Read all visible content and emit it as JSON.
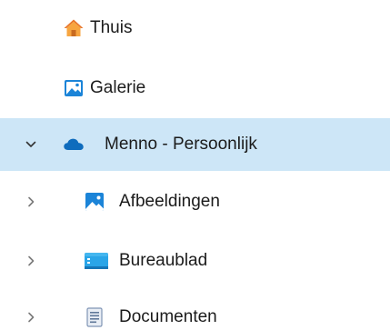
{
  "navigation_pane": {
    "items": [
      {
        "label": "Thuis",
        "icon": "home-icon",
        "expandable": false,
        "selected": false
      },
      {
        "label": "Galerie",
        "icon": "gallery-icon",
        "expandable": false,
        "selected": false
      },
      {
        "label": "Menno - Persoonlijk",
        "icon": "onedrive-cloud-icon",
        "expandable": true,
        "expanded": true,
        "selected": true
      },
      {
        "label": "Afbeeldingen",
        "icon": "pictures-folder-icon",
        "expandable": true,
        "expanded": false,
        "selected": false
      },
      {
        "label": "Bureaublad",
        "icon": "desktop-folder-icon",
        "expandable": true,
        "expanded": false,
        "selected": false
      },
      {
        "label": "Documenten",
        "icon": "documents-folder-icon",
        "expandable": true,
        "expanded": false,
        "selected": false
      }
    ]
  },
  "colors": {
    "selection_background": "#cde6f7",
    "onedrive_blue": "#0f6cbd",
    "home_orange": "#f7941d"
  }
}
